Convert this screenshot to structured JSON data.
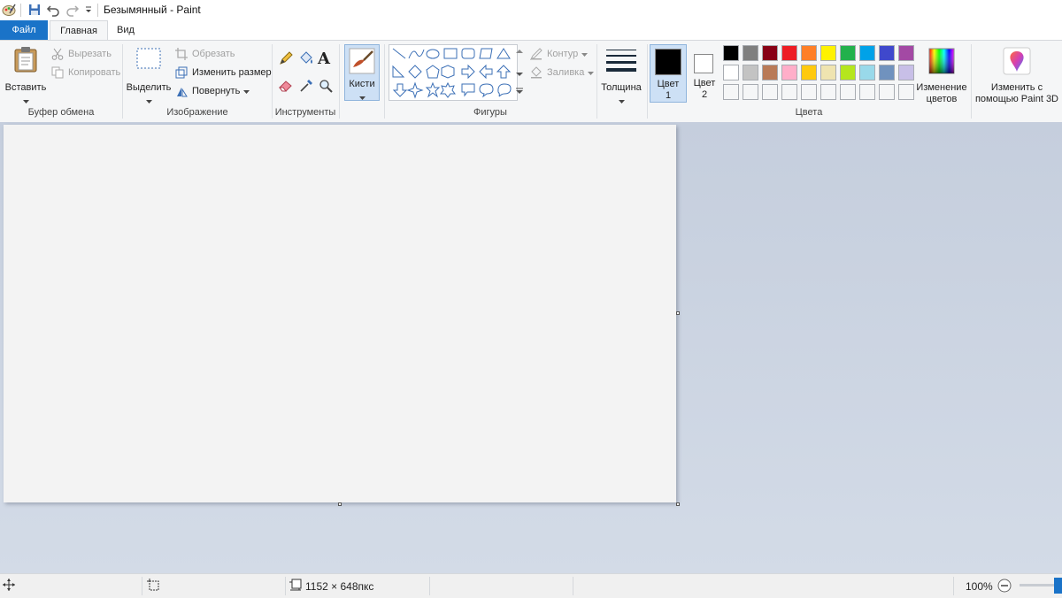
{
  "window": {
    "title": "Безымянный - Paint"
  },
  "tabs": {
    "file": "Файл",
    "home": "Главная",
    "view": "Вид"
  },
  "clipboard": {
    "paste": "Вставить",
    "cut": "Вырезать",
    "copy": "Копировать",
    "group_label": "Буфер обмена"
  },
  "image": {
    "select": "Выделить",
    "crop": "Обрезать",
    "resize": "Изменить размер",
    "rotate": "Повернуть",
    "group_label": "Изображение"
  },
  "tools": {
    "group_label": "Инструменты"
  },
  "brushes": {
    "label": "Кисти"
  },
  "shapes": {
    "outline": "Контур",
    "fill": "Заливка",
    "group_label": "Фигуры"
  },
  "size": {
    "label": "Толщина"
  },
  "colors": {
    "color1_line1": "Цвет",
    "color1_line2": "1",
    "color2_line1": "Цвет",
    "color2_line2": "2",
    "edit_line1": "Изменение",
    "edit_line2": "цветов",
    "group_label": "Цвета",
    "color1_value": "#000000",
    "color2_value": "#ffffff",
    "palette_row1": [
      "#000000",
      "#7f7f7f",
      "#880015",
      "#ed1c24",
      "#ff7f27",
      "#fff200",
      "#22b14c",
      "#00a2e8",
      "#3f48cc",
      "#a349a4"
    ],
    "palette_row2": [
      "#ffffff",
      "#c3c3c3",
      "#b97a57",
      "#ffaec9",
      "#ffc90e",
      "#efe4b0",
      "#b5e61d",
      "#99d9ea",
      "#7092be",
      "#c8bfe7"
    ]
  },
  "paint3d": {
    "line1": "Изменить с",
    "line2": "помощью Paint 3D"
  },
  "status": {
    "canvas_size": "1152 × 648пкс",
    "zoom": "100%"
  }
}
